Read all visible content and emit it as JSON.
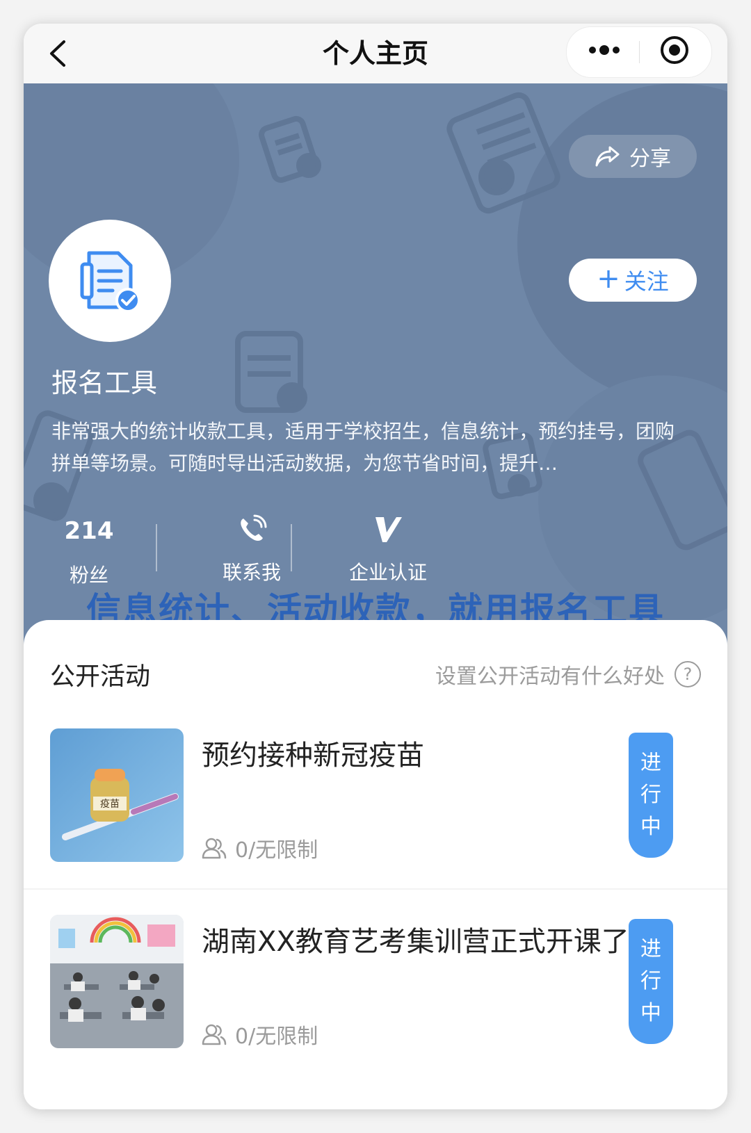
{
  "navbar": {
    "title": "个人主页"
  },
  "header": {
    "share_label": "分享",
    "follow_label": "关注",
    "name": "报名工具",
    "description": "非常强大的统计收款工具，适用于学校招生，信息统计，预约挂号，团购拼单等场景。可随时导出活动数据，为您节省时间，提升…",
    "stats": {
      "fans_count": "214",
      "fans_label": "粉丝",
      "contact_label": "联系我",
      "cert_label": "企业认证"
    },
    "slogan": "信息统计、活动收款，就用报名工具"
  },
  "panel": {
    "title": "公开活动",
    "help_text": "设置公开活动有什么好处",
    "help_icon": "?"
  },
  "activities": [
    {
      "title": "预约接种新冠疫苗",
      "participants": "0/无限制",
      "status": [
        "进",
        "行",
        "中"
      ],
      "thumb_label": "疫苗"
    },
    {
      "title": "湖南XX教育艺考集训营正式开课了",
      "participants": "0/无限制",
      "status": [
        "进",
        "行",
        "中"
      ]
    }
  ],
  "colors": {
    "header_bg": "#6f87a7",
    "accent_blue": "#3f8cf0",
    "status_blue": "#4d9cf2",
    "slogan_blue": "#2d63b8"
  }
}
